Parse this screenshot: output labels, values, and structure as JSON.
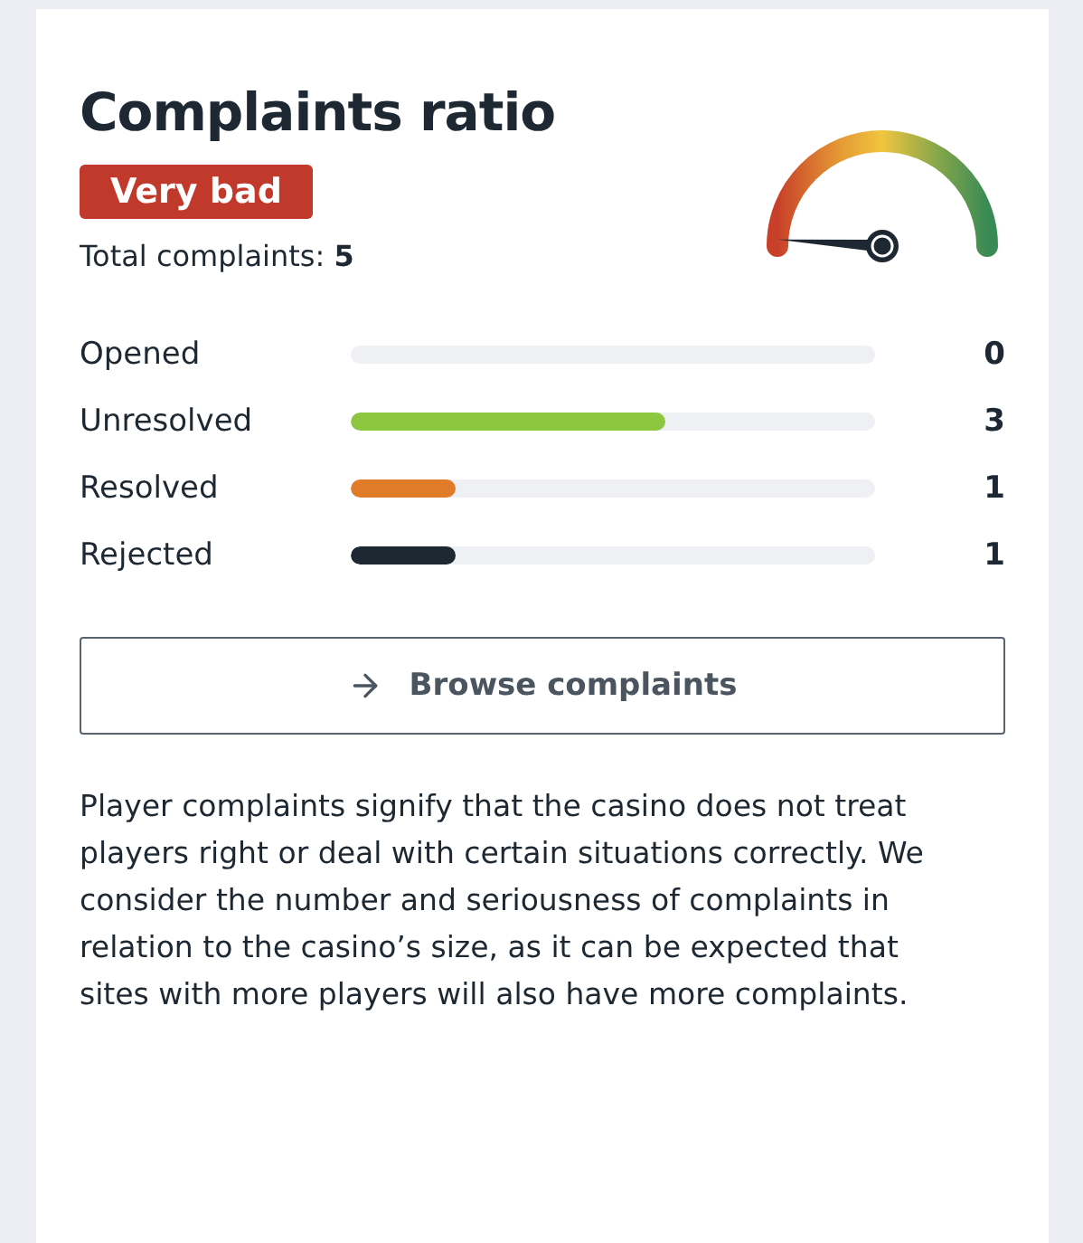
{
  "title": "Complaints ratio",
  "rating": {
    "label": "Very bad",
    "color": "#c0392b"
  },
  "total": "Total complaints: **5**",
  "stats": [
    {
      "label": "Opened",
      "value": "0"
    },
    {
      "label": "Unresolved",
      "level": 0.6,
      "value": "3",
      "color": "#8dc63f"
    },
    {
      "label": "Resolved",
      "level": 0.2,
      "value": "1",
      "color": "#e07b2a"
    },
    {
      "label": "Rejected",
      "level": 0.2,
      "value": "1",
      "color": "#1e2832"
    }
  ],
  "button": "Browse complaints",
  "description": "Player complaints signify that the casino does not treat players right or deal with certain situations correctly. We consider the number and seriousness of complaints in relation to the casino’s size, as it can be expected that sites with more players will also have more complaints."
}
